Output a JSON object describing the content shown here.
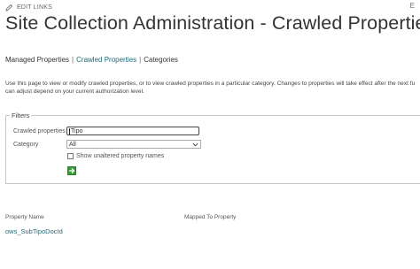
{
  "header": {
    "edit_links": "EDIT LINKS",
    "title": "Site Collection Administration - Crawled Properties",
    "corner_text": "E"
  },
  "nav": {
    "managed": "Managed Properties",
    "sep1": "|",
    "crawled": "Crawled Properties",
    "sep2": "|",
    "categories": "Categories"
  },
  "description": {
    "line1": "Use this page to view or modify crawled properties, or to view crawled properties in a particular category. Changes to properties will take effect after the next fu",
    "line2": "can adjust depend on your current authorization level."
  },
  "filters": {
    "legend": "Filters",
    "crawled_label": "Crawled properties",
    "crawled_value": "Tipo",
    "category_label": "Category",
    "category_value": "All",
    "checkbox_label": "Show unaltered property names",
    "checkbox_checked": false
  },
  "results": {
    "col_property_name": "Property Name",
    "col_mapped_to": "Mapped To Property",
    "rows": [
      {
        "name": "ows_SubTipoDocId",
        "mapped": ""
      }
    ]
  },
  "colors": {
    "link": "#1a6b7a",
    "go_button": "#3a9a3a"
  },
  "icons": {
    "edit": "pencil-icon",
    "go": "arrow-right-icon",
    "dropdown": "chevron-down-icon"
  }
}
